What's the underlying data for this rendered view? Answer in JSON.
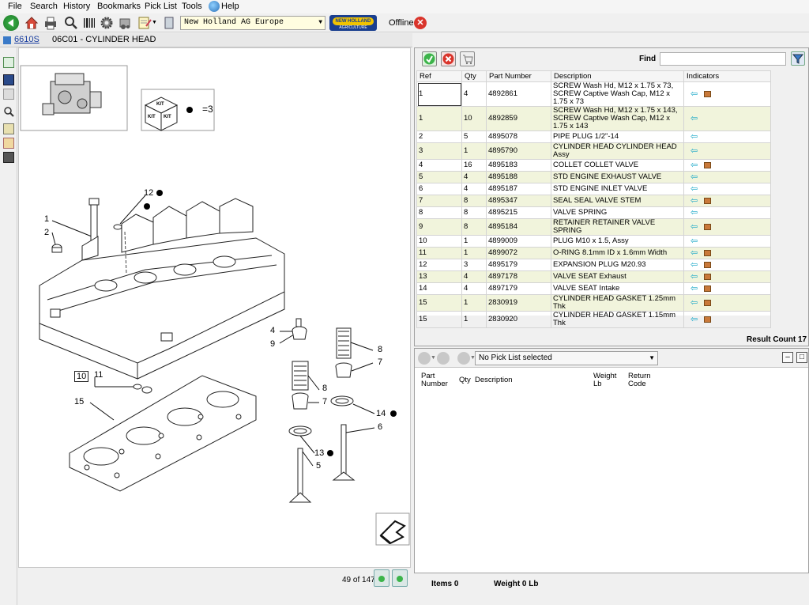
{
  "menu": [
    "File",
    "Search",
    "History",
    "Bookmarks",
    "Pick List",
    "Tools",
    "Help"
  ],
  "toolbar": {
    "region": "New Holland AG Europe",
    "brand": "NEW HOLLAND",
    "brand_sub": "AGRICULTURE",
    "status": "Offline"
  },
  "breadcrumb": {
    "model": "6610S",
    "title": "06C01 - CYLINDER HEAD"
  },
  "diagram": {
    "kit_label": "KIT",
    "kit_count": "=3",
    "callouts": [
      "1",
      "2",
      "12",
      "4",
      "9",
      "8",
      "7",
      "8",
      "7",
      "10",
      "11",
      "15",
      "14",
      "6",
      "13",
      "5"
    ],
    "page": "49 of 147"
  },
  "parts": {
    "find_label": "Find",
    "find_value": "",
    "columns": [
      "Ref",
      "Qty",
      "Part Number",
      "Description",
      "Indicators"
    ],
    "rows": [
      {
        "ref": "1",
        "qty": "4",
        "part": "4892861",
        "desc": "SCREW Wash Hd, M12 x 1.75 x 73, SCREW Captive Wash Cap, M12 x 1.75 x 73",
        "box": true
      },
      {
        "ref": "1",
        "qty": "10",
        "part": "4892859",
        "desc": "SCREW Wash Hd, M12 x 1.75 x 143, SCREW Captive Wash Cap, M12 x 1.75 x 143",
        "box": false
      },
      {
        "ref": "2",
        "qty": "5",
        "part": "4895078",
        "desc": "PIPE PLUG 1/2\"-14",
        "box": false
      },
      {
        "ref": "3",
        "qty": "1",
        "part": "4895790",
        "desc": "CYLINDER HEAD CYLINDER HEAD Assy",
        "box": false
      },
      {
        "ref": "4",
        "qty": "16",
        "part": "4895183",
        "desc": "COLLET COLLET VALVE",
        "box": true
      },
      {
        "ref": "5",
        "qty": "4",
        "part": "4895188",
        "desc": "STD ENGINE EXHAUST VALVE",
        "box": false
      },
      {
        "ref": "6",
        "qty": "4",
        "part": "4895187",
        "desc": "STD ENGINE INLET VALVE",
        "box": false
      },
      {
        "ref": "7",
        "qty": "8",
        "part": "4895347",
        "desc": "SEAL SEAL VALVE STEM",
        "box": true
      },
      {
        "ref": "8",
        "qty": "8",
        "part": "4895215",
        "desc": "VALVE SPRING",
        "box": false
      },
      {
        "ref": "9",
        "qty": "8",
        "part": "4895184",
        "desc": "RETAINER RETAINER VALVE SPRING",
        "box": true
      },
      {
        "ref": "10",
        "qty": "1",
        "part": "4899009",
        "desc": "PLUG M10 x 1.5, Assy",
        "box": false
      },
      {
        "ref": "11",
        "qty": "1",
        "part": "4899072",
        "desc": "O-RING 8.1mm ID x 1.6mm Width",
        "box": true
      },
      {
        "ref": "12",
        "qty": "3",
        "part": "4895179",
        "desc": "EXPANSION PLUG M20.93",
        "box": true
      },
      {
        "ref": "13",
        "qty": "4",
        "part": "4897178",
        "desc": "VALVE SEAT Exhaust",
        "box": true
      },
      {
        "ref": "14",
        "qty": "4",
        "part": "4897179",
        "desc": "VALVE SEAT Intake",
        "box": true
      },
      {
        "ref": "15",
        "qty": "1",
        "part": "2830919",
        "desc": "CYLINDER HEAD GASKET 1.25mm Thk",
        "box": true
      },
      {
        "ref": "15",
        "qty": "1",
        "part": "2830920",
        "desc": "CYLINDER HEAD GASKET 1.15mm Thk",
        "box": true
      }
    ],
    "result_count": "Result Count 17"
  },
  "picklist": {
    "selected": "No Pick List selected",
    "columns": [
      "Part Number",
      "Qty",
      "Description",
      "Weight Lb",
      "Return Code"
    ],
    "items": "Items 0",
    "weight": "Weight 0 Lb"
  },
  "colors": {
    "row_alt": "#f1f4dc",
    "indicator_arrow": "#19a8c8",
    "offline_red": "#d9342b"
  }
}
